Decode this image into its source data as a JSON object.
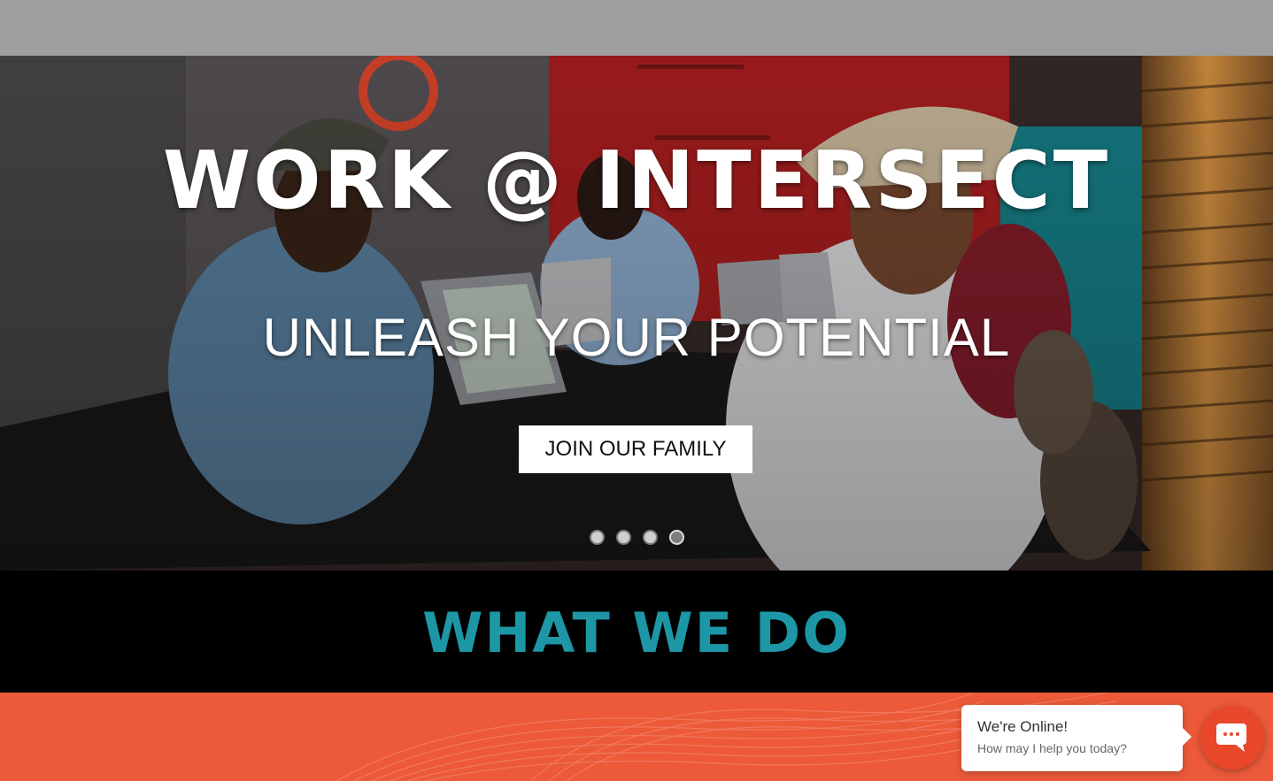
{
  "hero": {
    "title": "WORK @ INTERSECT",
    "subtitle": "UNLEASH YOUR POTENTIAL",
    "cta_label": "JOIN OUR FAMILY",
    "slide_count": 4,
    "active_slide": 4
  },
  "section": {
    "heading": "WHAT WE DO"
  },
  "chat": {
    "status": "We're Online!",
    "prompt": "How may I help you today?",
    "icon": "chat-icon"
  },
  "colors": {
    "topbar": "#9e9e9e",
    "heading_teal": "#1d97a6",
    "orange_band": "#ec5a3a",
    "chat_button": "#e8472a"
  }
}
